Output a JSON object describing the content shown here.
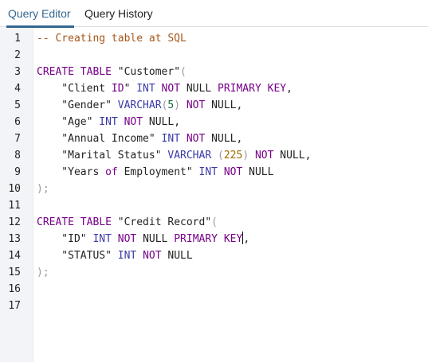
{
  "tabs": [
    {
      "label": "Query Editor",
      "active": true
    },
    {
      "label": "Query History",
      "active": false
    }
  ],
  "colors": {
    "accent": "#326690",
    "keyword": "#770088",
    "type": "#3a3aa8",
    "comment": "#a8561b",
    "gutter_bg": "#f2f4f7"
  },
  "editor": {
    "line_numbers": [
      "1",
      "2",
      "3",
      "4",
      "5",
      "6",
      "7",
      "8",
      "9",
      "10",
      "11",
      "12",
      "13",
      "14",
      "15",
      "16",
      "17"
    ],
    "lines": [
      [
        {
          "t": "-- Creating table at SQL",
          "k": "comment"
        }
      ],
      [],
      [
        {
          "t": "CREATE TABLE",
          "k": "keyword"
        },
        {
          "t": " \"Customer\"",
          "k": "plain"
        },
        {
          "t": "(",
          "k": "paren"
        }
      ],
      [
        {
          "t": "    \"Client ",
          "k": "plain"
        },
        {
          "t": "ID",
          "k": "keyword"
        },
        {
          "t": "\" ",
          "k": "plain"
        },
        {
          "t": "INT",
          "k": "type"
        },
        {
          "t": " ",
          "k": "plain"
        },
        {
          "t": "NOT",
          "k": "keyword"
        },
        {
          "t": " NULL ",
          "k": "plain"
        },
        {
          "t": "PRIMARY KEY",
          "k": "keyword"
        },
        {
          "t": ",",
          "k": "plain"
        }
      ],
      [
        {
          "t": "    \"Gender\" ",
          "k": "plain"
        },
        {
          "t": "VARCHAR",
          "k": "type"
        },
        {
          "t": "(",
          "k": "paren"
        },
        {
          "t": "5",
          "k": "number"
        },
        {
          "t": ")",
          "k": "paren"
        },
        {
          "t": " ",
          "k": "plain"
        },
        {
          "t": "NOT",
          "k": "keyword"
        },
        {
          "t": " NULL,",
          "k": "plain"
        }
      ],
      [
        {
          "t": "    \"Age\" ",
          "k": "plain"
        },
        {
          "t": "INT",
          "k": "type"
        },
        {
          "t": " ",
          "k": "plain"
        },
        {
          "t": "NOT",
          "k": "keyword"
        },
        {
          "t": " NULL,",
          "k": "plain"
        }
      ],
      [
        {
          "t": "    \"Annual Income\" ",
          "k": "plain"
        },
        {
          "t": "INT",
          "k": "type"
        },
        {
          "t": " ",
          "k": "plain"
        },
        {
          "t": "NOT",
          "k": "keyword"
        },
        {
          "t": " NULL,",
          "k": "plain"
        }
      ],
      [
        {
          "t": "    \"Marital Status\" ",
          "k": "plain"
        },
        {
          "t": "VARCHAR",
          "k": "type"
        },
        {
          "t": " (",
          "k": "paren"
        },
        {
          "t": "225",
          "k": "number-amber"
        },
        {
          "t": ")",
          "k": "paren"
        },
        {
          "t": " ",
          "k": "plain"
        },
        {
          "t": "NOT",
          "k": "keyword"
        },
        {
          "t": " NULL,",
          "k": "plain"
        }
      ],
      [
        {
          "t": "    \"Years ",
          "k": "plain"
        },
        {
          "t": "of",
          "k": "keyword"
        },
        {
          "t": " Employment\" ",
          "k": "plain"
        },
        {
          "t": "INT",
          "k": "type"
        },
        {
          "t": " ",
          "k": "plain"
        },
        {
          "t": "NOT",
          "k": "keyword"
        },
        {
          "t": " NULL",
          "k": "plain"
        }
      ],
      [
        {
          "t": ");",
          "k": "paren"
        }
      ],
      [],
      [
        {
          "t": "CREATE TABLE",
          "k": "keyword"
        },
        {
          "t": " \"Credit Record\"",
          "k": "plain"
        },
        {
          "t": "(",
          "k": "paren"
        }
      ],
      [
        {
          "t": "    \"ID\" ",
          "k": "plain"
        },
        {
          "t": "INT",
          "k": "type"
        },
        {
          "t": " ",
          "k": "plain"
        },
        {
          "t": "NOT",
          "k": "keyword"
        },
        {
          "t": " NULL ",
          "k": "plain"
        },
        {
          "t": "PRIMARY KEY",
          "k": "keyword"
        },
        {
          "t": "",
          "k": "cursor"
        },
        {
          "t": ",",
          "k": "plain"
        }
      ],
      [
        {
          "t": "    \"STATUS\" ",
          "k": "plain"
        },
        {
          "t": "INT",
          "k": "type"
        },
        {
          "t": " ",
          "k": "plain"
        },
        {
          "t": "NOT",
          "k": "keyword"
        },
        {
          "t": " NULL",
          "k": "plain"
        }
      ],
      [
        {
          "t": ");",
          "k": "paren"
        }
      ],
      [],
      []
    ]
  }
}
